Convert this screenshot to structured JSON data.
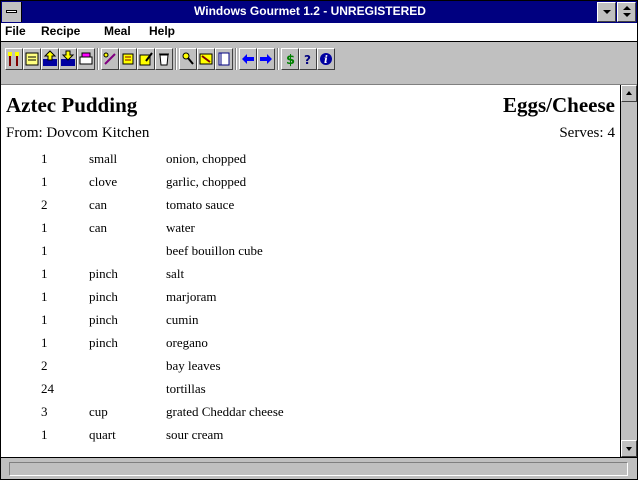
{
  "window": {
    "title": "Windows Gourmet 1.2 - UNREGISTERED"
  },
  "menu": [
    {
      "label": "File"
    },
    {
      "label": "Recipe"
    },
    {
      "label": "Meal"
    },
    {
      "label": "Help"
    }
  ],
  "toolbar_icons": [
    "fork-knife-icon",
    "open-recipe-icon",
    "import-recipe-icon",
    "export-recipe-icon",
    "print-icon",
    "scale-recipe-icon",
    "shopping-list-icon",
    "edit-recipe-icon",
    "clear-icon",
    "search-icon",
    "filter-icon",
    "meal-plan-icon",
    "previous-arrow-icon",
    "next-arrow-icon",
    "cost-icon",
    "help-icon",
    "info-icon"
  ],
  "recipe": {
    "title": "Aztec Pudding",
    "category": "Eggs/Cheese",
    "source": "From: Dovcom Kitchen",
    "serves_label": "Serves:",
    "serves": "4",
    "ingredients": [
      {
        "qty": "1",
        "unit": "small",
        "name": "onion, chopped"
      },
      {
        "qty": "1",
        "unit": "clove",
        "name": "garlic, chopped"
      },
      {
        "qty": "2",
        "unit": "can",
        "name": "tomato sauce"
      },
      {
        "qty": "1",
        "unit": "can",
        "name": "water"
      },
      {
        "qty": "1",
        "unit": "",
        "name": "beef bouillon cube"
      },
      {
        "qty": "1",
        "unit": "pinch",
        "name": "salt"
      },
      {
        "qty": "1",
        "unit": "pinch",
        "name": "marjoram"
      },
      {
        "qty": "1",
        "unit": "pinch",
        "name": "cumin"
      },
      {
        "qty": "1",
        "unit": "pinch",
        "name": "oregano"
      },
      {
        "qty": "2",
        "unit": "",
        "name": "bay leaves"
      },
      {
        "qty": "24",
        "unit": "",
        "name": "tortillas"
      },
      {
        "qty": "3",
        "unit": "cup",
        "name": "grated Cheddar cheese"
      },
      {
        "qty": "1",
        "unit": "quart",
        "name": "sour cream"
      }
    ]
  },
  "status": {
    "text": ""
  },
  "colors": {
    "titlebar": "#000080",
    "face": "#c0c0c0",
    "content": "#ffffff"
  }
}
